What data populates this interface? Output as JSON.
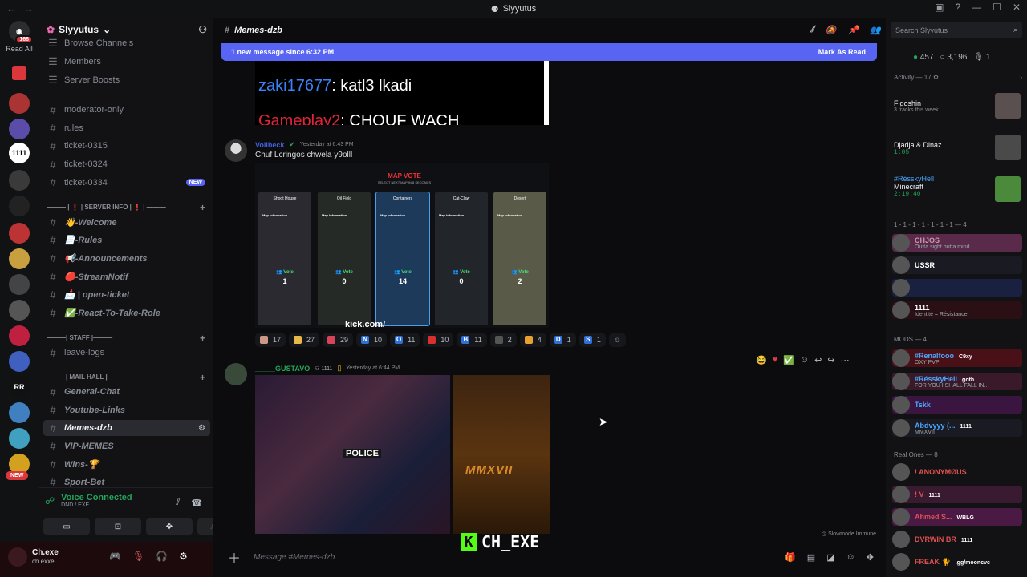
{
  "window": {
    "title": "Slyyutus"
  },
  "rail": {
    "unread_count": "168",
    "read_all": "Read All",
    "new_label": "NEW"
  },
  "sidebar": {
    "server_name": "Slyyutus",
    "top_items": [
      "Browse Channels",
      "Members",
      "Server Boosts"
    ],
    "channels_a": [
      {
        "label": "moderator-only"
      },
      {
        "label": "rules"
      },
      {
        "label": "ticket-0315"
      },
      {
        "label": "ticket-0324"
      },
      {
        "label": "ticket-0334",
        "badge": "NEW"
      }
    ],
    "cat_server_info": "——— | ❗ | SERVER INFO | ❗ | ———",
    "channels_b": [
      "👋-Welcome",
      "📄-Rules",
      "📢-Announcements",
      "🔴-StreamNotif",
      "📩 | open-ticket",
      "✅-React-To-Take-Role"
    ],
    "cat_staff": "———| STAFF |———",
    "channels_c": [
      "leave-logs"
    ],
    "cat_mail": "———| MAIL HALL |———",
    "channels_d": [
      "General-Chat",
      "Youtube-Links",
      "Memes-dzb",
      "VIP-MEMES",
      "Wins-🏆",
      "Sport-Bet"
    ]
  },
  "voice": {
    "title": "Voice Connected",
    "status": "DND / EXE"
  },
  "user": {
    "name": "Ch.exe",
    "handle": "ch.exxe"
  },
  "channel": {
    "name": "Memes-dzb",
    "new_message_bar": "1 new message since 6:32 PM",
    "mark_read": "Mark As Read",
    "composer_placeholder": "Message #Memes-dzb",
    "slowmode": "Slowmode Immune"
  },
  "embed_top": {
    "user1": "zaki17677",
    "text1": ": katl3 lkadi",
    "user2": "Gameplay2",
    "text2": ": CHOUF WACH"
  },
  "message1": {
    "author": "Vollbeck",
    "timestamp": "Yesterday at 6:43 PM",
    "text": "Chuf Lcringos chwela y9olll",
    "map_title": "MAP VOTE",
    "map_subtitle": "SELECT NEXT MAP IN 8 SECONDS",
    "maps": [
      {
        "name": "Shoot House",
        "votes": "1"
      },
      {
        "name": "Oil Field",
        "votes": "0"
      },
      {
        "name": "Containers",
        "votes": "14"
      },
      {
        "name": "Cat-Claw",
        "votes": "0"
      },
      {
        "name": "Desert",
        "votes": "2"
      }
    ],
    "vote_label": "Vote",
    "map_info": "Map Information",
    "kick_text": "kick.com/",
    "reactions": [
      {
        "count": "17",
        "color": "#c98"
      },
      {
        "count": "27",
        "color": "#e8b84a"
      },
      {
        "count": "29",
        "color": "#d6445a"
      },
      {
        "letter": "N",
        "count": "10",
        "color": "#2f6fd6"
      },
      {
        "letter": "O",
        "count": "11",
        "color": "#2f6fd6"
      },
      {
        "count": "10",
        "color": "#d63030"
      },
      {
        "letter": "B",
        "count": "11",
        "color": "#2f6fd6"
      },
      {
        "count": "2",
        "color": "#555"
      },
      {
        "count": "4",
        "color": "#e8a030"
      },
      {
        "letter": "D",
        "count": "1",
        "color": "#2f6fd6"
      },
      {
        "letter": "S",
        "count": "1",
        "color": "#2f6fd6"
      }
    ]
  },
  "message2": {
    "author": "_____GUSTAVO",
    "tag": "1111",
    "timestamp": "Yesterday at 6:44 PM",
    "police_text": "POLICE"
  },
  "watermark": "CH_EXE",
  "members": {
    "search_placeholder": "Search Slyyutus",
    "online": "457",
    "idle": "3,196",
    "voice": "1",
    "activity_header": "Activity — 17",
    "activities": [
      {
        "name": "Figoshin",
        "sub": "3 tracks this week",
        "color": "#5a5050"
      },
      {
        "name": "Djadja & Dinaz",
        "sub": "1:05",
        "color": "#4a4a4a"
      },
      {
        "name": "Minecraft",
        "user": "#RésskyHell",
        "sub": "2:19:40",
        "color": "#4a8a3a"
      }
    ],
    "group1_header": "1 - 1 - 1 - 1 - 1 - 1 - 1 — 4",
    "group1": [
      {
        "name": "CHJOS",
        "sub": "Outta sight outta mind",
        "color": "#c9a",
        "bg": "#5a2a4a"
      },
      {
        "name": "USSR",
        "sub": "",
        "color": "#fff",
        "bg": "#1a1a22"
      },
      {
        "name": "",
        "sub": "",
        "color": "#fff",
        "bg": "#1a2040"
      },
      {
        "name": "1111",
        "sub": "Identité = Résistance",
        "color": "#fff",
        "bg": "#2a1015"
      }
    ],
    "mods_header": "MODS — 4",
    "mods": [
      {
        "name": "#Renalfooo",
        "tag": "C9xy",
        "sub": "OXY PVP",
        "color": "#4aa8ff",
        "bg": "#4a1018"
      },
      {
        "name": "#RésskyHell",
        "tag": "goth",
        "sub": "FOR YOU I SHALL FALL IN...",
        "color": "#4aa8ff",
        "bg": "#3a1a2a"
      },
      {
        "name": "Tskk",
        "tag": "",
        "sub": "",
        "color": "#4aa8ff",
        "bg": "#3a1540"
      },
      {
        "name": "Abdvyyy (...",
        "tag": "1111",
        "sub": "MMXVII",
        "color": "#4aa8ff",
        "bg": "#1a1a22"
      }
    ],
    "real_header": "Real Ones — 8",
    "real": [
      {
        "name": "! ANONYMØUS",
        "tag": "",
        "color": "#e05050",
        "bg": "#121215"
      },
      {
        "name": "! V",
        "tag": "1111",
        "color": "#e05050",
        "bg": "#3a1a30"
      },
      {
        "name": "Ahmed S...",
        "tag": "WBLG",
        "color": "#e05050",
        "bg": "#4a1a45"
      },
      {
        "name": "DVRWIN BR",
        "tag": "1111",
        "color": "#e05050",
        "bg": "#121215"
      },
      {
        "name": "FREAK 🐈",
        "tag": ".gg/mooncvc",
        "color": "#e05050",
        "bg": "#121215"
      }
    ]
  }
}
